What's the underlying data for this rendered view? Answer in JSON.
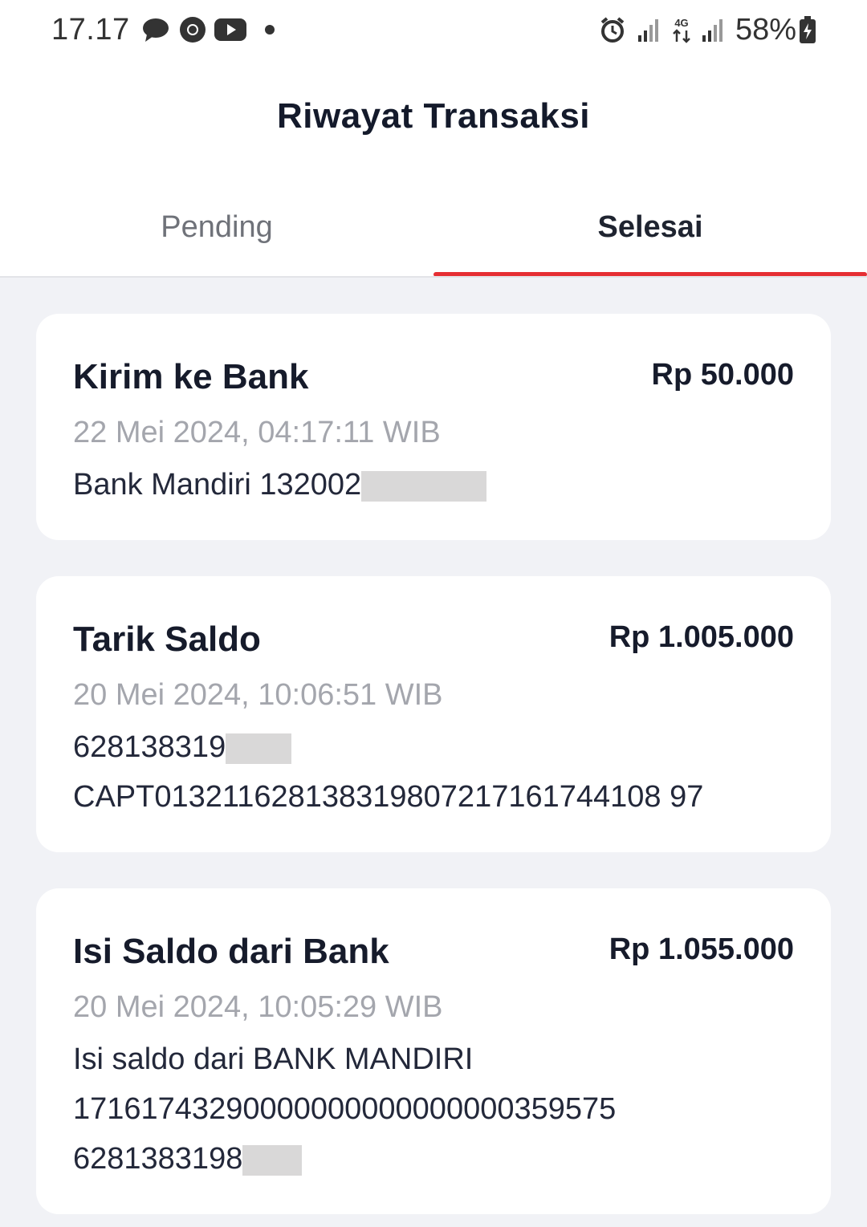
{
  "status_bar": {
    "time": "17.17",
    "battery_percent": "58%",
    "network": "4G",
    "left_icons": [
      "chat-bubble-icon",
      "chrome-icon",
      "youtube-icon",
      "dot-icon"
    ],
    "right_icons": [
      "alarm-icon",
      "signal-icon",
      "network-4g-icon",
      "signal-icon",
      "battery-charging-icon"
    ]
  },
  "header": {
    "title": "Riwayat Transaksi"
  },
  "tabs": [
    {
      "label": "Pending",
      "active": false
    },
    {
      "label": "Selesai",
      "active": true
    }
  ],
  "colors": {
    "accent": "#e62e33",
    "background": "#f1f2f6",
    "card": "#ffffff",
    "muted_text": "#a4a6ad",
    "redaction": "#d9d8d8"
  },
  "transactions": [
    {
      "title": "Kirim ke Bank",
      "amount": "Rp 50.000",
      "datetime": "22 Mei 2024, 04:17:11 WIB",
      "lines": [
        "Bank Mandiri 132002"
      ]
    },
    {
      "title": "Tarik Saldo",
      "amount": "Rp 1.005.000",
      "datetime": "20 Mei 2024, 10:06:51 WIB",
      "lines": [
        "628138319",
        "CAPT013211628138319807217161744108 97"
      ]
    },
    {
      "title": "Isi Saldo dari Bank",
      "amount": "Rp 1.055.000",
      "datetime": "20 Mei 2024, 10:05:29 WIB",
      "lines": [
        "Isi saldo dari BANK MANDIRI",
        "17161743290000000000000000359575",
        "6281383198"
      ]
    }
  ]
}
